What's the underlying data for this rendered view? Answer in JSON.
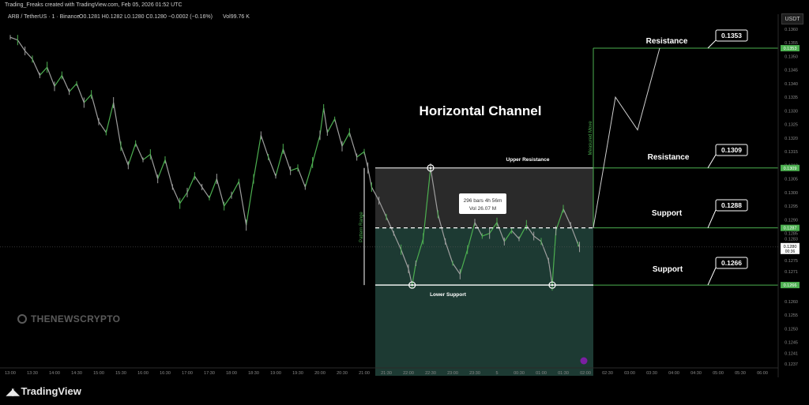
{
  "header": {
    "attribution": "Trading_Freaks created with TradingView.com, Feb 05, 2026 01:52 UTC",
    "symbol": "ARB / TetherUS · 1 · Binance",
    "ohlc": "O0.1281 H0.1282 L0.1280 C0.1280 −0.0002 (−0.16%)",
    "volume": "Vol99.76 K",
    "currency": "USDT"
  },
  "branding": {
    "tradingview": "TradingView",
    "watermark": "THENEWSCRYPTO"
  },
  "chart_data": {
    "type": "line",
    "title": "Horizontal Channel",
    "x_ticks": [
      "13:00",
      "13:30",
      "14:00",
      "14:30",
      "15:00",
      "15:30",
      "16:00",
      "16:30",
      "17:00",
      "17:30",
      "18:00",
      "18:30",
      "19:00",
      "19:30",
      "20:00",
      "20:30",
      "21:00",
      "21:30",
      "22:00",
      "22:30",
      "23:00",
      "23:30",
      "5",
      "00:30",
      "01:00",
      "01:30",
      "02:00",
      "02:30",
      "03:00",
      "03:30",
      "04:00",
      "04:30",
      "05:00",
      "05:30",
      "06:00"
    ],
    "y_ticks": [
      "0.1360",
      "0.1355",
      "0.1350",
      "0.1345",
      "0.1340",
      "0.1335",
      "0.1330",
      "0.1325",
      "0.1320",
      "0.1315",
      "0.1310",
      "0.1305",
      "0.1300",
      "0.1295",
      "0.1290",
      "0.1285",
      "0.1283",
      "0.1275",
      "0.1271",
      "0.1260",
      "0.1255",
      "0.1250",
      "0.1245",
      "0.1241",
      "0.1237"
    ],
    "ylim": [
      0.1235,
      0.1362
    ],
    "current_price": {
      "value": "0.1280",
      "countdown": "00:36"
    },
    "price_series": [
      [
        "13:00",
        0.1357
      ],
      [
        "13:10",
        0.1356
      ],
      [
        "13:20",
        0.1352
      ],
      [
        "13:30",
        0.1349
      ],
      [
        "13:40",
        0.1343
      ],
      [
        "13:50",
        0.1346
      ],
      [
        "14:00",
        0.1339
      ],
      [
        "14:10",
        0.1343
      ],
      [
        "14:20",
        0.1337
      ],
      [
        "14:30",
        0.134
      ],
      [
        "14:40",
        0.1333
      ],
      [
        "14:50",
        0.1336
      ],
      [
        "15:00",
        0.1326
      ],
      [
        "15:10",
        0.1322
      ],
      [
        "15:20",
        0.1333
      ],
      [
        "15:30",
        0.1317
      ],
      [
        "15:40",
        0.131
      ],
      [
        "15:50",
        0.1318
      ],
      [
        "16:00",
        0.1312
      ],
      [
        "16:10",
        0.1314
      ],
      [
        "16:20",
        0.1305
      ],
      [
        "16:30",
        0.1312
      ],
      [
        "16:40",
        0.1302
      ],
      [
        "16:50",
        0.1296
      ],
      [
        "17:00",
        0.13
      ],
      [
        "17:10",
        0.1306
      ],
      [
        "17:20",
        0.1302
      ],
      [
        "17:30",
        0.1298
      ],
      [
        "17:40",
        0.1305
      ],
      [
        "17:50",
        0.1295
      ],
      [
        "18:00",
        0.1299
      ],
      [
        "18:10",
        0.1304
      ],
      [
        "18:20",
        0.1288
      ],
      [
        "18:30",
        0.1305
      ],
      [
        "18:40",
        0.1321
      ],
      [
        "18:50",
        0.1313
      ],
      [
        "19:00",
        0.1306
      ],
      [
        "19:10",
        0.1316
      ],
      [
        "19:20",
        0.1308
      ],
      [
        "19:30",
        0.1309
      ],
      [
        "19:40",
        0.1302
      ],
      [
        "19:50",
        0.1311
      ],
      [
        "20:00",
        0.1321
      ],
      [
        "20:05",
        0.1331
      ],
      [
        "20:10",
        0.1322
      ],
      [
        "20:20",
        0.1327
      ],
      [
        "20:30",
        0.1317
      ],
      [
        "20:40",
        0.1322
      ],
      [
        "20:50",
        0.1313
      ],
      [
        "21:00",
        0.1315
      ],
      [
        "21:05",
        0.1309
      ],
      [
        "21:10",
        0.1302
      ],
      [
        "21:20",
        0.1297
      ],
      [
        "21:30",
        0.1291
      ],
      [
        "21:40",
        0.1285
      ],
      [
        "21:50",
        0.1279
      ],
      [
        "22:00",
        0.1272
      ],
      [
        "22:05",
        0.1266
      ],
      [
        "22:10",
        0.1274
      ],
      [
        "22:20",
        0.1283
      ],
      [
        "22:30",
        0.1309
      ],
      [
        "22:40",
        0.1292
      ],
      [
        "22:50",
        0.1282
      ],
      [
        "23:00",
        0.1274
      ],
      [
        "23:10",
        0.127
      ],
      [
        "23:20",
        0.1279
      ],
      [
        "23:30",
        0.1289
      ],
      [
        "23:40",
        0.1284
      ],
      [
        "23:50",
        0.1285
      ],
      [
        "00:00",
        0.1289
      ],
      [
        "00:10",
        0.1282
      ],
      [
        "00:20",
        0.1286
      ],
      [
        "00:30",
        0.1283
      ],
      [
        "00:40",
        0.1288
      ],
      [
        "00:50",
        0.1284
      ],
      [
        "01:00",
        0.1282
      ],
      [
        "01:10",
        0.1275
      ],
      [
        "01:15",
        0.1266
      ],
      [
        "01:20",
        0.1286
      ],
      [
        "01:30",
        0.1294
      ],
      [
        "01:40",
        0.1288
      ],
      [
        "01:50",
        0.1281
      ],
      [
        "01:52",
        0.128
      ]
    ],
    "annotations": {
      "channel": {
        "upper": 0.1309,
        "mid": 0.1287,
        "lower": 0.1266,
        "x_start": "21:00",
        "x_end": "02:00"
      },
      "horizontal_levels": [
        {
          "id": "resistance_top",
          "name": "Resistance",
          "value": "0.1353",
          "price": 0.1353,
          "color": "#4caf50"
        },
        {
          "id": "resistance_mid",
          "name": "Resistance",
          "value": "0.1309",
          "price": 0.1309,
          "color": "#4caf50"
        },
        {
          "id": "support_mid",
          "name": "Support",
          "value": "0.1288",
          "price": 0.1287,
          "color": "#4caf50"
        },
        {
          "id": "support_low",
          "name": "Support",
          "value": "0.1266",
          "price": 0.1266,
          "color": "#4caf50"
        }
      ],
      "channel_labels": {
        "upper": "Upper Resistance",
        "lower": "Lower Support",
        "pattern_range": "Pattern Range",
        "measured_move": "Measured Move"
      },
      "info_box": {
        "bars": "296 bars",
        "duration": "4h 56m",
        "volume": "Vol 26.07 M"
      },
      "axis_badges": [
        {
          "value": "0.1353",
          "price": 0.1353
        },
        {
          "value": "0.1309",
          "price": 0.1309
        },
        {
          "value": "0.1287",
          "price": 0.1287
        },
        {
          "value": "0.1266",
          "price": 0.1266
        }
      ],
      "touch_points": [
        [
          "22:30",
          0.1309
        ],
        [
          "22:05",
          0.1266
        ],
        [
          "01:15",
          0.1266
        ]
      ],
      "projection_path": [
        [
          "02:00",
          0.1287
        ],
        [
          "02:30",
          0.1335
        ],
        [
          "03:00",
          0.1323
        ],
        [
          "03:30",
          0.1353
        ]
      ]
    },
    "colors": {
      "up": "#4caf50",
      "down": "#9e9e9e",
      "channel_upper": "#2a2a2a",
      "channel_lower": "#1d3a33",
      "level": "#4caf50"
    }
  }
}
